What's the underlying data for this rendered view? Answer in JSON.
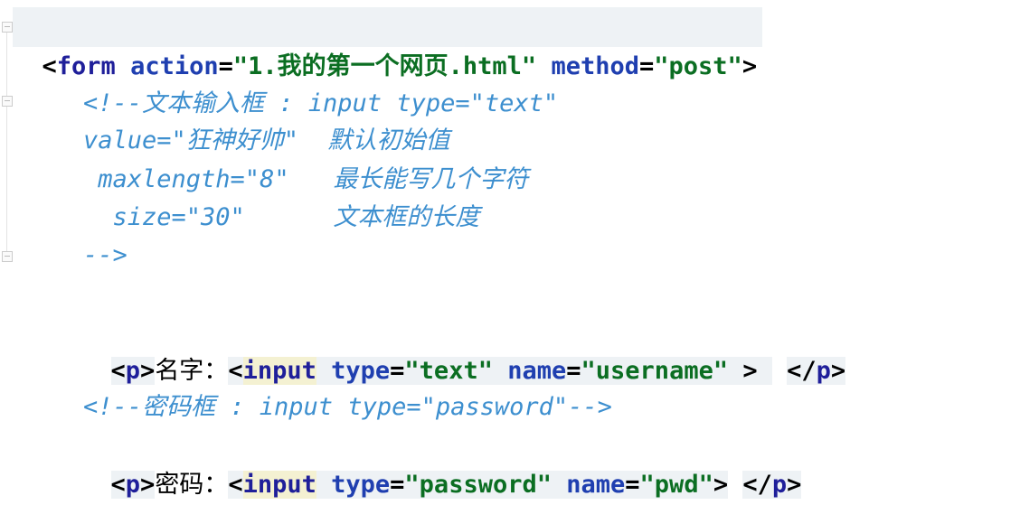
{
  "editor": {
    "line1": {
      "open": "<",
      "tag": "form",
      "sp1": " ",
      "a1": "action",
      "eq1": "=",
      "v1": "\"1.我的第一个网页.html\"",
      "sp2": " ",
      "a2": "method",
      "eq2": "=",
      "v2": "\"post\"",
      "close": ">"
    },
    "comment1": [
      "<!--文本输入框 : input type=\"text\"",
      "value=\"狂神好帅\"  默认初始值",
      " maxlength=\"8\"   最长能写几个字符",
      "  size=\"30\"      文本框的长度",
      "-->"
    ],
    "line_username": {
      "lt": "<",
      "p": "p",
      "gt": ">",
      "label": "名字：",
      "lt2": "<",
      "input": "input",
      "sp1": " ",
      "a1": "type",
      "eq1": "=",
      "v1": "\"text\"",
      "sp2": " ",
      "a2": "name",
      "eq2": "=",
      "v2": "\"username\"",
      "tail": " > ",
      "endlt": "</",
      "endp": "p",
      "endgt": ">"
    },
    "comment2": "<!--密码框 : input type=\"password\"-->",
    "line_pwd": {
      "lt": "<",
      "p": "p",
      "gt": ">",
      "label": "密码：",
      "lt2": "<",
      "input": "input",
      "sp1": " ",
      "a1": "type",
      "eq1": "=",
      "v1": "\"password\"",
      "sp2": " ",
      "a2": "name",
      "eq2": "=",
      "v2": "\"pwd\"",
      "gt2": ">",
      "sp3": " ",
      "endlt": "</",
      "endp": "p",
      "endgt": ">"
    }
  },
  "colors": {
    "tag": "#1f1f9a",
    "attribute": "#1f3fb0",
    "value": "#0b6e22",
    "comment": "#3d8fcf",
    "line_highlight": "#eef2f5"
  }
}
